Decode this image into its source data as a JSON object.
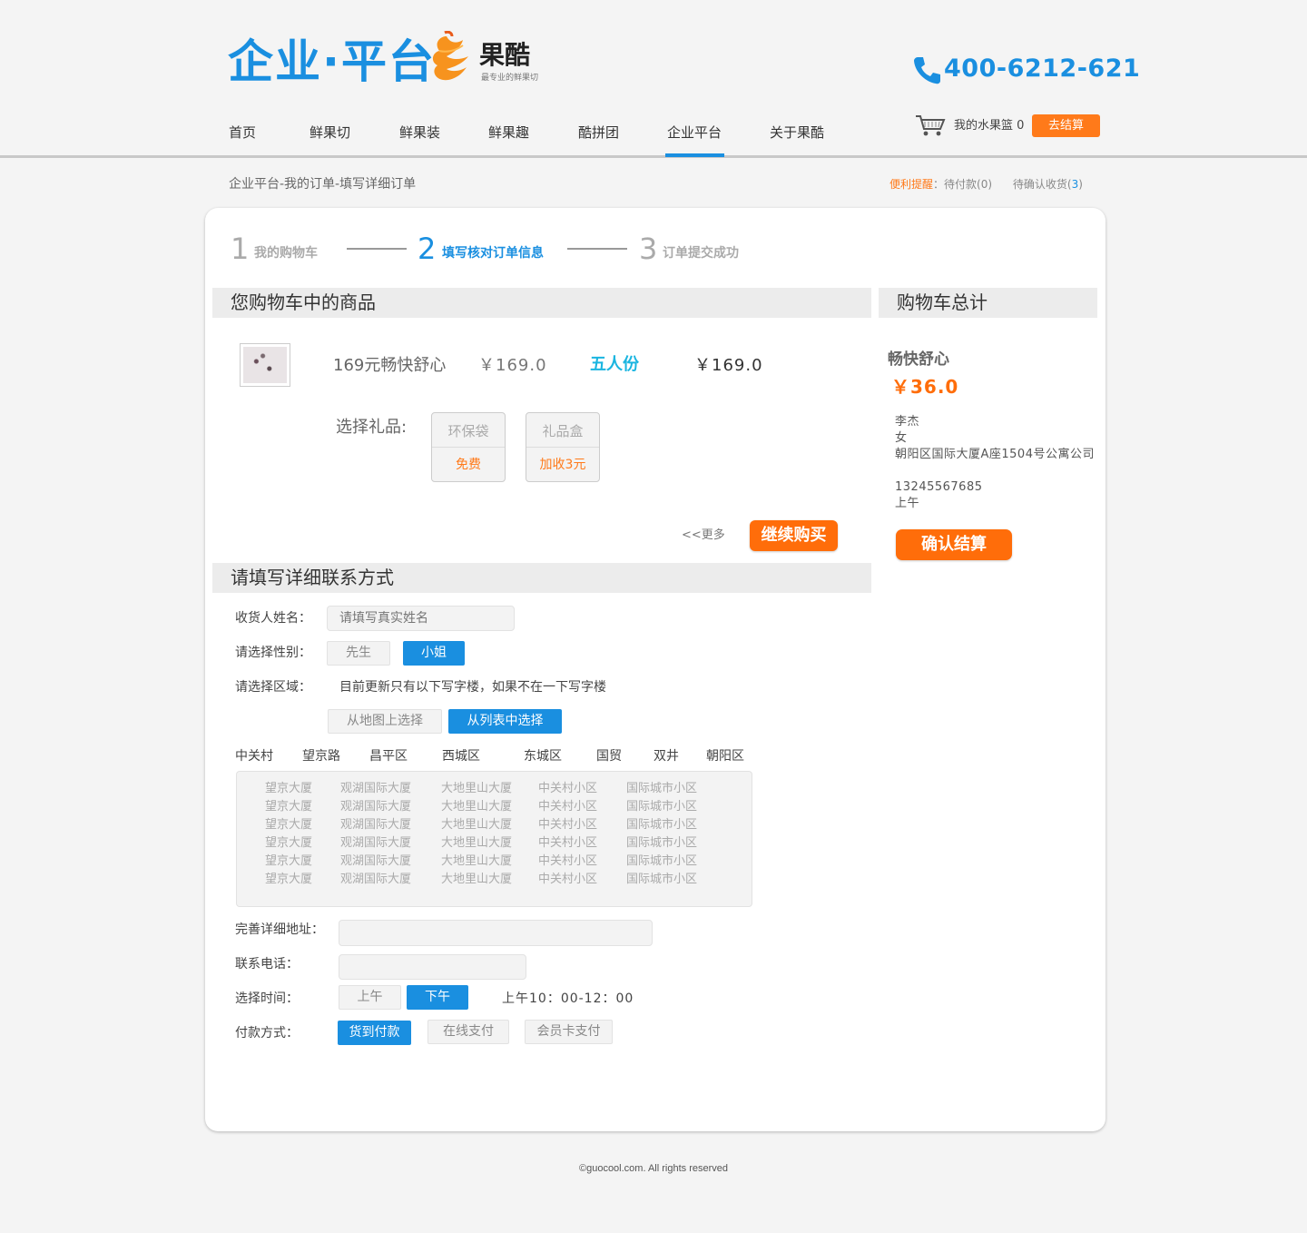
{
  "header": {
    "logo_text": "企业",
    "logo_sep": "·",
    "logo_text2": "平台",
    "brand_name": "果酷",
    "brand_tagline": "最专业的鲜果切",
    "phone": "400-6212-621",
    "accent_color": "#1a8fe0",
    "orange_color": "#ff7a1a"
  },
  "nav": {
    "items": [
      {
        "label": "首页"
      },
      {
        "label": "鲜果切"
      },
      {
        "label": "鲜果装"
      },
      {
        "label": "鲜果趣"
      },
      {
        "label": "酷拼团"
      },
      {
        "label": "企业平台"
      },
      {
        "label": "关于果酷"
      }
    ],
    "active": "企业平台"
  },
  "cart": {
    "label": "我的水果篮",
    "count": "0",
    "checkout_label": "去结算"
  },
  "breadcrumb": "企业平台-我的订单-填写详细订单",
  "reminder": {
    "label": "便利提醒",
    "sep": "：",
    "pending_pay": "待付款(0)",
    "pending_receive_prefix": "待确认收货(",
    "pending_receive_count": "3",
    "pending_receive_suffix": ")"
  },
  "steps": [
    {
      "num": "1",
      "label": "我的购物车"
    },
    {
      "num": "2",
      "label": "填写核对订单信息"
    },
    {
      "num": "3",
      "label": "订单提交成功"
    }
  ],
  "cart_section": {
    "title": "您购物车中的商品",
    "product": {
      "name": "169元畅快舒心",
      "price": "￥169.0",
      "portion": "五人份",
      "total": "￥169.0"
    },
    "gift_label": "选择礼品:",
    "gifts": [
      {
        "title": "环保袋",
        "price": "免费"
      },
      {
        "title": "礼品盒",
        "price": "加收3元"
      }
    ],
    "more_link": "<<更多",
    "continue_label": "继续购买"
  },
  "summary": {
    "title": "购物车总计",
    "item_name": "畅快舒心",
    "item_price": "￥36.0",
    "name": "李杰",
    "gender": "女",
    "address": "朝阳区国际大厦A座1504号公寓公司",
    "phone": "13245567685",
    "time": "上午",
    "confirm_label": "确认结算"
  },
  "contact": {
    "title": "请填写详细联系方式",
    "name_label": "收货人姓名：",
    "name_placeholder": "请填写真实姓名",
    "gender_label": "请选择性别：",
    "gender_options": [
      "先生",
      "小姐"
    ],
    "gender_selected": "小姐",
    "region_label": "请选择区域：",
    "region_note": "目前更新只有以下写字楼，如果不在一下写字楼",
    "region_modes": [
      "从地图上选择",
      "从列表中选择"
    ],
    "region_mode_selected": "从列表中选择",
    "districts": [
      "中关村",
      "望京路",
      "昌平区",
      "西城区",
      "东城区",
      "国贸",
      "双井",
      "朝阳区"
    ],
    "buildings": [
      "望京大厦",
      "观湖国际大厦",
      "大地里山大厦",
      "中关村小区",
      "国际城市小区"
    ],
    "building_rows": 6,
    "address_label": "完善详细地址：",
    "phone_label": "联系电话：",
    "time_label": "选择时间：",
    "time_options": [
      "上午",
      "下午"
    ],
    "time_selected": "下午",
    "time_note": "上午10：00-12：00",
    "pay_label": "付款方式：",
    "pay_options": [
      "货到付款",
      "在线支付",
      "会员卡支付"
    ],
    "pay_selected": "货到付款"
  },
  "footer": "©guocool.com. All rights reserved"
}
